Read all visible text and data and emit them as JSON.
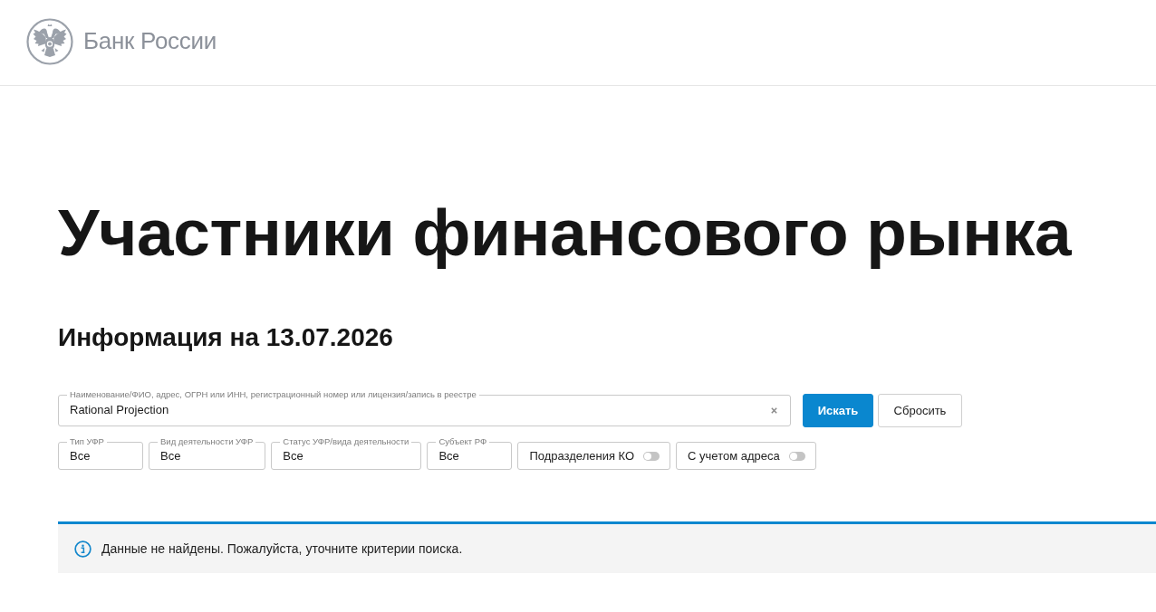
{
  "header": {
    "logo_text": "Банк России"
  },
  "page_title": "Участники финансового рынка",
  "info_date": "Информация на 13.07.2026",
  "search": {
    "label": "Наименование/ФИО, адрес, ОГРН или ИНН, регистрационный номер или лицензия/запись в реестре",
    "value": "Rational Projection"
  },
  "buttons": [
    {
      "label": "Искать",
      "kind": "primary"
    },
    {
      "label": "Сбросить",
      "kind": "secondary"
    }
  ],
  "filters": [
    {
      "kind": "select",
      "label": "Тип УФР",
      "value": "Все"
    },
    {
      "kind": "select",
      "label": "Вид деятельности УФР",
      "value": "Все"
    },
    {
      "kind": "select",
      "label": "Статус УФР/вида деятельности",
      "value": "Все"
    },
    {
      "kind": "select",
      "label": "Субъект РФ",
      "value": "Все"
    },
    {
      "kind": "toggle",
      "label": "Подразделения КО",
      "on": false
    },
    {
      "kind": "toggle",
      "label": "С учетом адреса",
      "on": false
    }
  ],
  "notice": {
    "kind": "info",
    "text": "Данные не найдены. Пожалуйста, уточните критерии поиска."
  }
}
